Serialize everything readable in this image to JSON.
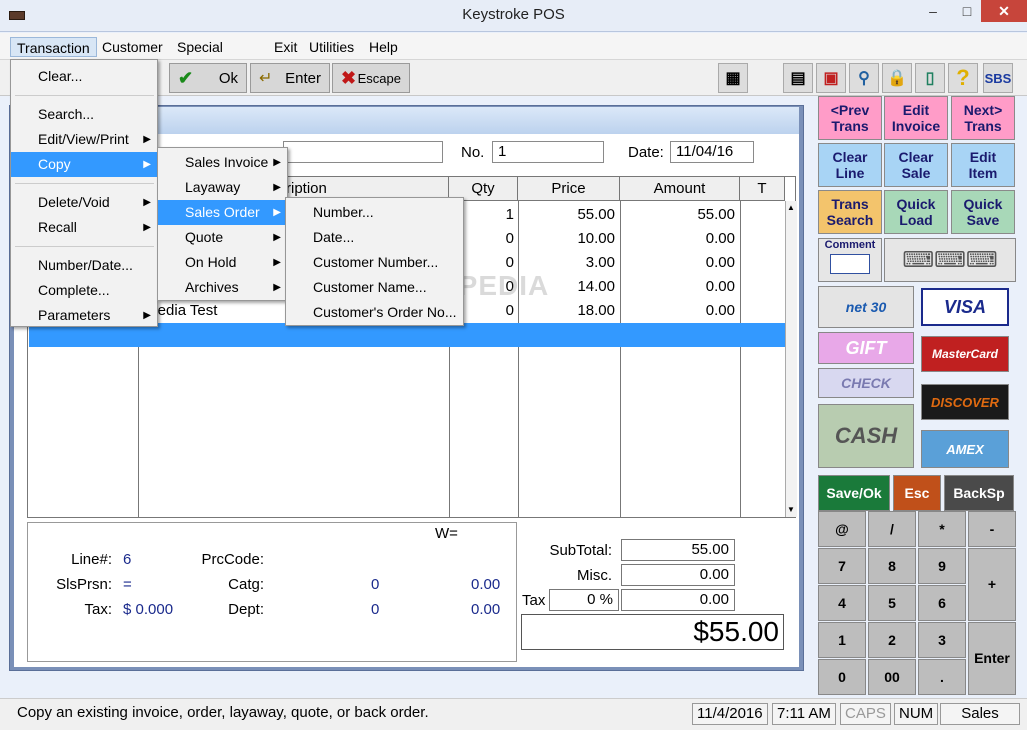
{
  "window": {
    "title": "Keystroke POS",
    "min": "–",
    "max": "□",
    "close": "✕"
  },
  "menubar": [
    "Transaction",
    "Customer",
    "Special",
    "Exit",
    "Utilities",
    "Help"
  ],
  "toolbar": {
    "ok": "Ok",
    "enter": "Enter",
    "escape": "Escape"
  },
  "header": {
    "no_label": "No.",
    "no_value": "1",
    "date_label": "Date:",
    "date_value": "11/04/16"
  },
  "grid": {
    "columns": [
      "ription",
      "Qty",
      "Price",
      "Amount",
      "T"
    ],
    "rows": [
      {
        "qty": "1",
        "price": "55.00",
        "amount": "55.00"
      },
      {
        "qty": "0",
        "price": "10.00",
        "amount": "0.00"
      },
      {
        "qty": "0",
        "price": "3.00",
        "amount": "0.00"
      },
      {
        "qty": "0",
        "price": "14.00",
        "amount": "0.00"
      },
      {
        "qty": "0",
        "price": "18.00",
        "amount": "0.00",
        "desc": "ftpedia Test"
      }
    ]
  },
  "bottom": {
    "w": "W=",
    "line_label": "Line#:",
    "line_value": "6",
    "slsprsn_label": "SlsPrsn:",
    "slsprsn_value": "=",
    "tax_label": "Tax:",
    "tax_value": "$  0.000",
    "prccode_label": "PrcCode:",
    "catg_label": "Catg:",
    "catg_a": "0",
    "catg_b": "0.00",
    "dept_label": "Dept:",
    "dept_a": "0",
    "dept_b": "0.00"
  },
  "totals": {
    "subtotal_label": "SubTotal:",
    "subtotal": "55.00",
    "misc_label": "Misc.",
    "misc": "0.00",
    "tax_label": "Tax",
    "tax_pct": "0 %",
    "tax": "0.00",
    "total": "$55.00"
  },
  "rightpanel": {
    "buttons": [
      "<Prev\nTrans",
      "Edit\nInvoice",
      "Next>\nTrans",
      "Clear\nLine",
      "Clear\nSale",
      "Edit\nItem",
      "Trans\nSearch",
      "Quick\nLoad",
      "Quick\nSave"
    ],
    "comment": "Comment",
    "payments": {
      "net30": "net 30",
      "visa": "VISA",
      "gift": "GIFT",
      "mastercard": "MasterCard",
      "check": "CHECK",
      "discover": "DISCOVER",
      "cash": "CASH",
      "amex": "AMEX"
    },
    "action_keys": [
      "Save/Ok",
      "Esc",
      "BackSp"
    ],
    "keypad": [
      "@",
      "/",
      "*",
      "-",
      "7",
      "8",
      "9",
      "+",
      "4",
      "5",
      "6",
      "1",
      "2",
      "3",
      "Enter",
      "0",
      "00",
      "."
    ]
  },
  "menus": {
    "transaction": [
      "Clear...",
      "Search...",
      "Edit/View/Print",
      "Copy",
      "Delete/Void",
      "Recall",
      "Number/Date...",
      "Complete...",
      "Parameters"
    ],
    "copy": [
      "Sales Invoice",
      "Layaway",
      "Sales Order",
      "Quote",
      "On Hold",
      "Archives"
    ],
    "salesorder": [
      "Number...",
      "Date...",
      "Customer Number...",
      "Customer Name...",
      "Customer's Order No..."
    ]
  },
  "watermark": "SOFTPEDIA",
  "status": {
    "message": "Copy an existing invoice, order, layaway, quote, or back order.",
    "date": "11/4/2016",
    "time": "7:11 AM",
    "caps": "CAPS",
    "num": "NUM",
    "mode": "Sales"
  }
}
